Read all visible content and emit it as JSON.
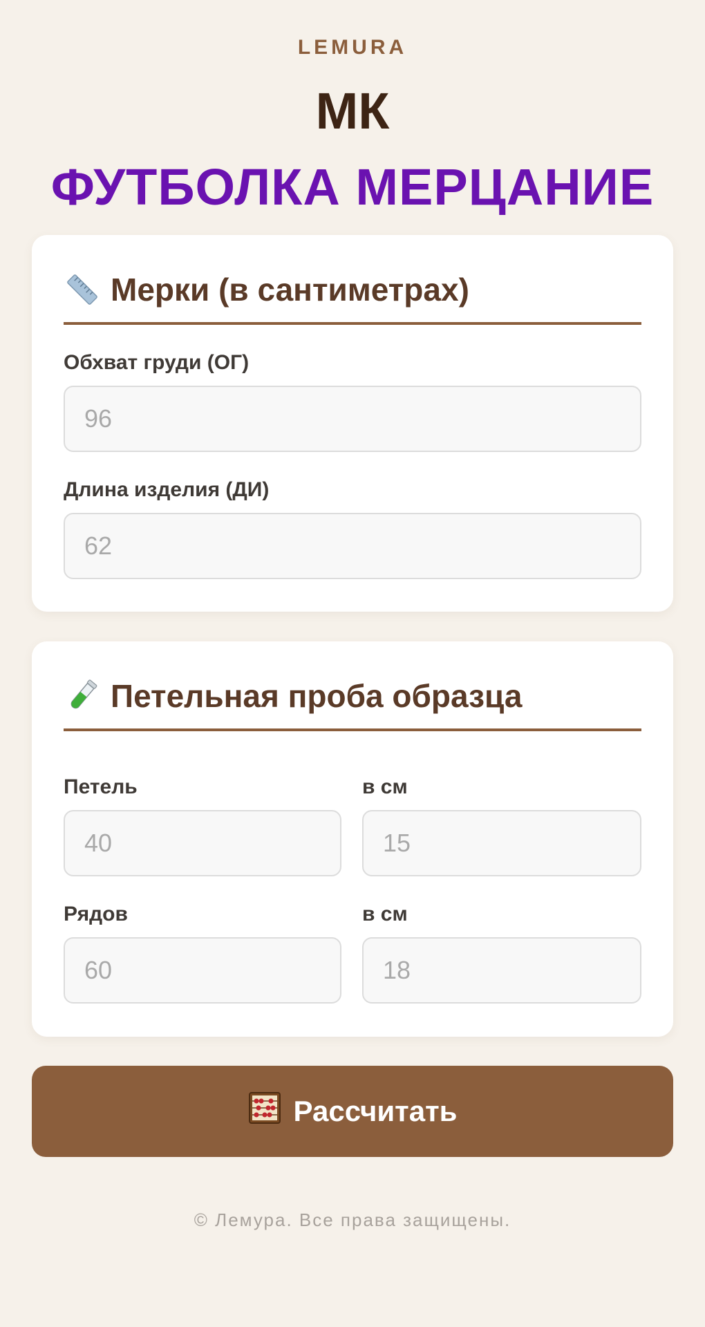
{
  "header": {
    "brand": "LEMURA",
    "title": "МК",
    "subtitle": "ФУТБОЛКА МЕРЦАНИЕ"
  },
  "measurements": {
    "heading": "Мерки (в сантиметрах)",
    "icon": "ruler-icon",
    "chest": {
      "label": "Обхват груди (ОГ)",
      "placeholder": "96"
    },
    "length": {
      "label": "Длина изделия (ДИ)",
      "placeholder": "62"
    }
  },
  "gauge": {
    "heading": "Петельная проба образца",
    "icon": "test-tube-icon",
    "stitches": {
      "label": "Петель",
      "placeholder": "40"
    },
    "stitches_cm": {
      "label": "в см",
      "placeholder": "15"
    },
    "rows": {
      "label": "Рядов",
      "placeholder": "60"
    },
    "rows_cm": {
      "label": "в см",
      "placeholder": "18"
    }
  },
  "calculate": {
    "label": "Рассчитать",
    "icon": "abacus-icon"
  },
  "footer": {
    "copyright": "© Лемура. Все права защищены."
  },
  "colors": {
    "background": "#f6f1ea",
    "accent": "#8b5e3c",
    "title_purple": "#6a12b0",
    "dark_brown": "#3d2414"
  }
}
